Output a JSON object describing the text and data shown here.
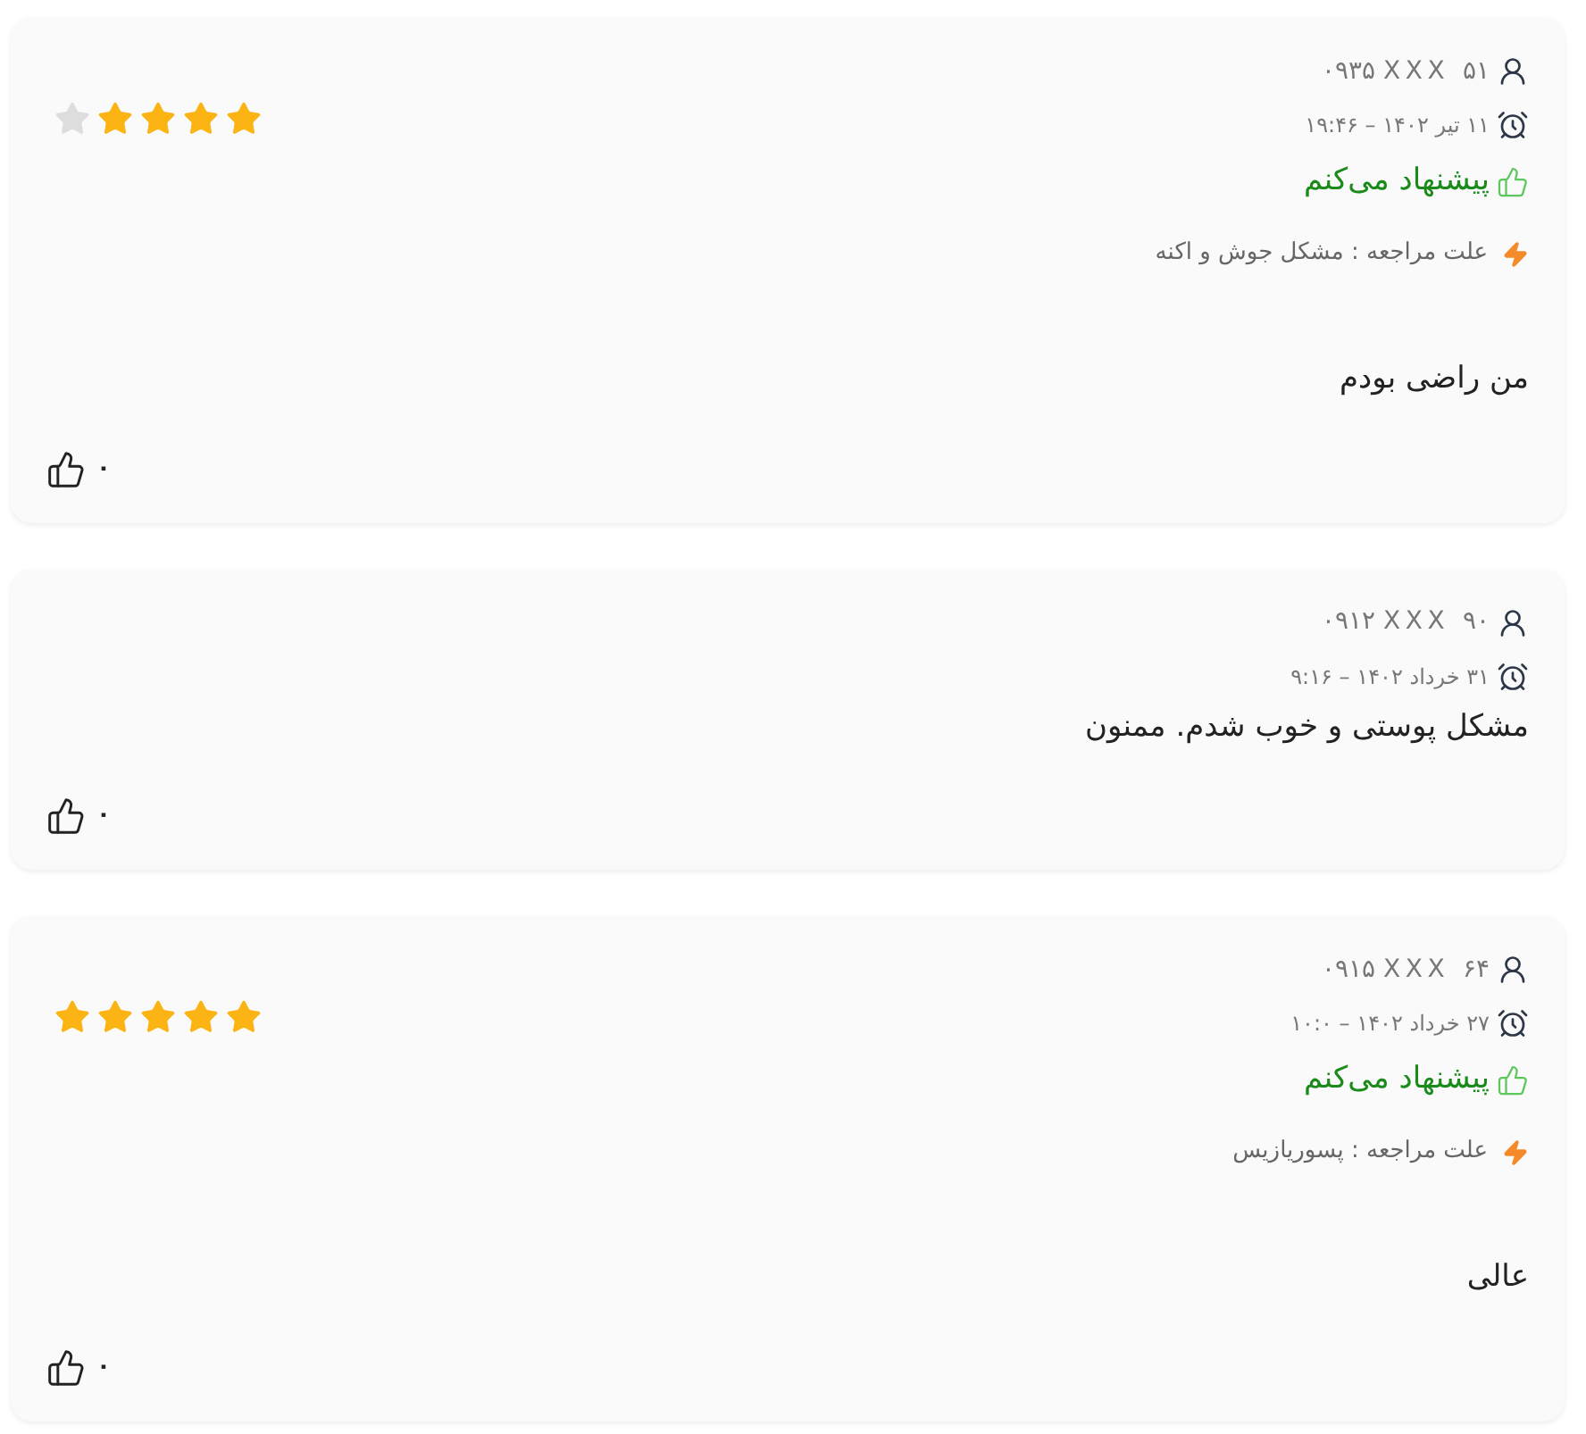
{
  "reviews": [
    {
      "phone": "۰۹۳۵ XXX ۵۱",
      "date": "۱۱ تیر ۱۴۰۲ – ۱۹:۴۶",
      "stars": 4,
      "recommendation": "پیشنهاد می‌کنم",
      "reason": "علت مراجعه : مشکل جوش و اکنه",
      "comment": "من راضی بودم",
      "likes": "۰"
    },
    {
      "phone": "۰۹۱۲ XXX ۹۰",
      "date": "۳۱ خرداد ۱۴۰۲ – ۹:۱۶",
      "comment": "مشکل پوستی و خوب شدم. ممنون",
      "likes": "۰"
    },
    {
      "phone": "۰۹۱۵ XXX ۶۴",
      "date": "۲۷ خرداد ۱۴۰۲ – ۱۰:۰",
      "stars": 5,
      "recommendation": "پیشنهاد می‌کنم",
      "reason": "علت مراجعه : پسوریازیس",
      "comment": "عالی",
      "likes": "۰"
    }
  ]
}
